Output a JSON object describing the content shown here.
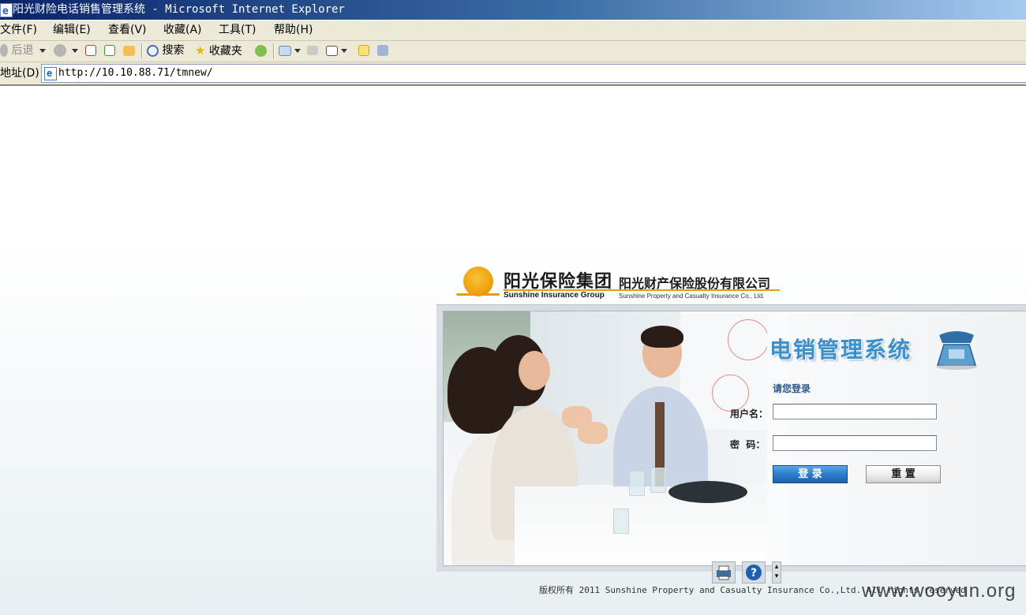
{
  "window": {
    "title": "阳光财险电话销售管理系统 - Microsoft Internet Explorer"
  },
  "menubar": {
    "items": [
      {
        "label": "文件(F)"
      },
      {
        "label": "编辑(E)"
      },
      {
        "label": "查看(V)"
      },
      {
        "label": "收藏(A)"
      },
      {
        "label": "工具(T)"
      },
      {
        "label": "帮助(H)"
      }
    ]
  },
  "toolbar": {
    "back_label": "后退",
    "search_label": "搜索",
    "favorites_label": "收藏夹",
    "icons": [
      "back-icon",
      "forward-icon",
      "stop-icon",
      "refresh-icon",
      "home-icon",
      "search-icon",
      "favorites-icon",
      "media-icon",
      "mail-icon",
      "print-icon",
      "edit-icon",
      "discuss-icon",
      "messenger-icon"
    ]
  },
  "addressbar": {
    "label": "地址(D)",
    "url": "http://10.10.88.71/tmnew/"
  },
  "logo": {
    "group_cn": "阳光保险集团",
    "group_en": "Sunshine Insurance Group",
    "company_cn": "阳光财产保险股份有限公司",
    "company_en": "Sunshine Property and Casualty Insurance Co., Ltd."
  },
  "login": {
    "system_title": "电销管理系统",
    "prompt": "请您登录",
    "username_label": "用户名：",
    "password_label": "密  码：",
    "username_value": "",
    "password_value": "",
    "login_button": "登 录",
    "reset_button": "重 置"
  },
  "footer": {
    "copyright": "版权所有 2011 Sunshine Property and Casualty Insurance Co.,Ltd. All rights reserved",
    "watermark": "www.wooyun.org"
  },
  "colors": {
    "titlebar_start": "#0a246a",
    "chrome": "#ece9d8",
    "system_title": "#3d8fc9",
    "login_button": "#2b7ccb",
    "brand_orange": "#f0a10d"
  }
}
